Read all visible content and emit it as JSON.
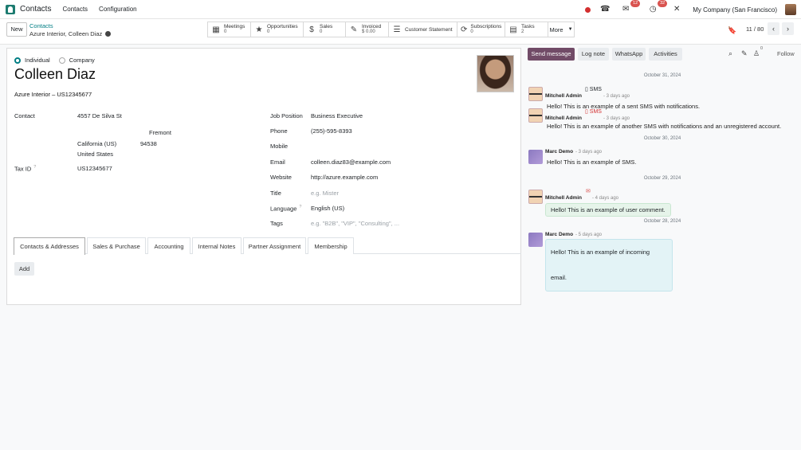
{
  "topnav": {
    "app_name": "Contacts",
    "menu": [
      "Contacts",
      "Configuration"
    ],
    "icons": [
      "status-dot",
      "phone-icon",
      "chat-icon",
      "activity-clock-icon",
      "tools-icon"
    ],
    "chat_badge": "12",
    "activity_badge": "32",
    "company": "My Company (San Francisco)"
  },
  "controlbar": {
    "new_label": "New",
    "breadcrumb_parent": "Contacts",
    "breadcrumb_current": "Azure Interior, Colleen Diaz",
    "smart_buttons": [
      {
        "label": "Meetings",
        "value": "0",
        "icon": "calendar-icon"
      },
      {
        "label": "Opportunities",
        "value": "0",
        "icon": "star-icon"
      },
      {
        "label": "Sales",
        "value": "0",
        "icon": "dollar-icon"
      },
      {
        "label": "Invoiced",
        "value": "$ 0.00",
        "icon": "pencil-square-icon"
      },
      {
        "label": "Customer Statement",
        "value": "",
        "icon": "list-icon"
      },
      {
        "label": "Subscriptions",
        "value": "0",
        "icon": "refresh-icon"
      },
      {
        "label": "Tasks",
        "value": "2",
        "icon": "tasks-icon"
      }
    ],
    "more_label": "More",
    "pager": "11 / 80"
  },
  "form": {
    "type_individual": "Individual",
    "type_company": "Company",
    "name": "Colleen Diaz",
    "company_line": "Azure Interior – US12345677",
    "contact_label": "Contact",
    "street": "4557 De Silva St",
    "city": "Fremont",
    "state": "California (US)",
    "zip": "94538",
    "country": "United States",
    "tax_label": "Tax ID",
    "tax_help": "?",
    "tax_value": "US12345677",
    "job_label": "Job Position",
    "job_value": "Business Executive",
    "phone_label": "Phone",
    "phone_value": "(255)-595-8393",
    "mobile_label": "Mobile",
    "email_label": "Email",
    "email_value": "colleen.diaz83@example.com",
    "website_label": "Website",
    "website_value": "http://azure.example.com",
    "title_label": "Title",
    "title_placeholder": "e.g. Mister",
    "language_label": "Language",
    "language_help": "?",
    "language_value": "English (US)",
    "tags_label": "Tags",
    "tags_placeholder": "e.g. \"B2B\", \"VIP\", \"Consulting\", ...",
    "tabs": [
      "Contacts & Addresses",
      "Sales & Purchase",
      "Accounting",
      "Internal Notes",
      "Partner Assignment",
      "Membership"
    ],
    "add_label": "Add"
  },
  "chatter": {
    "send_message": "Send message",
    "log_note": "Log note",
    "whatsapp": "WhatsApp",
    "activities": "Activities",
    "followers_count": "0",
    "follow": "Follow",
    "dates": [
      "October 31, 2024",
      "October 30, 2024",
      "October 29, 2024",
      "October 28, 2024"
    ],
    "messages": [
      {
        "author": "Mitchell Admin",
        "ago": "- 3 days ago",
        "tag": "SMS",
        "text": "Hello! This is an example of a sent SMS with notifications."
      },
      {
        "author": "Mitchell Admin",
        "ago": "- 3 days ago",
        "tag": "SMS",
        "text": "Hello! This is an example of another SMS with notifications and an unregistered account."
      },
      {
        "author": "Marc Demo",
        "ago": "- 3 days ago",
        "tag": "",
        "text": "Hello! This is an example of SMS."
      },
      {
        "author": "Mitchell Admin",
        "ago": "- 4 days ago",
        "tag": "",
        "text": "Hello! This is an example of user comment."
      },
      {
        "author": "Marc Demo",
        "ago": "- 5 days ago",
        "tag": "",
        "text": "Hello! This is an example of incoming email."
      }
    ]
  }
}
